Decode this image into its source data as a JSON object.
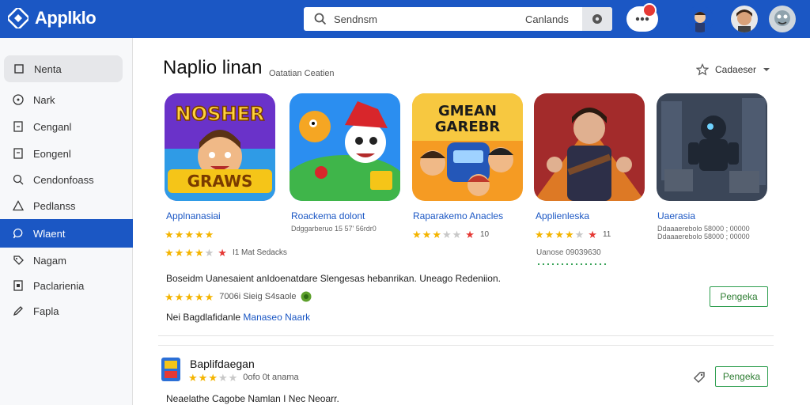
{
  "app": {
    "title": "Applklo"
  },
  "search": {
    "placeholder": "Sendnsm",
    "scope": "Canlands"
  },
  "sidebar": {
    "items": [
      {
        "label": "Nenta",
        "icon": "square-icon"
      },
      {
        "label": "Nark",
        "icon": "compass-icon"
      },
      {
        "label": "Cenganl",
        "icon": "page-icon"
      },
      {
        "label": "Eongenl",
        "icon": "page-icon"
      },
      {
        "label": "Cendonfoass",
        "icon": "search-icon"
      },
      {
        "label": "Pedlanss",
        "icon": "triangle-icon"
      },
      {
        "label": "Wlaent",
        "icon": "chat-icon"
      },
      {
        "label": "Nagam",
        "icon": "tag-icon"
      },
      {
        "label": "Paclarienia",
        "icon": "page-icon"
      },
      {
        "label": "Fapla",
        "icon": "pen-icon"
      }
    ],
    "active_index": 6
  },
  "main": {
    "title": "Naplio linan",
    "subtitle": "Oatatian Ceatien",
    "sort_label": "Cadaeser"
  },
  "apps": [
    {
      "name": "Applnanasiai",
      "art_label": "NOSHER GRAWS",
      "rating": 5,
      "extra_rating": 3.5,
      "extra_text": "I1 Mat Sedacks",
      "sub": ""
    },
    {
      "name": "Roackema dolont",
      "art_label": "",
      "rating": 0,
      "sub": "Ddggarberuo 15 57' 56rdr0"
    },
    {
      "name": "Raparakemo Anacles",
      "art_label": "GMEAN GAREBR",
      "rating": 3,
      "rating_text": "10",
      "sub": ""
    },
    {
      "name": "Applienleska",
      "art_label": "",
      "rating": 4,
      "rating_text": "11",
      "sub": "Uanose 09039630"
    },
    {
      "name": "Uaerasia",
      "art_label": "",
      "rating": 0,
      "sub": "Ddaaaerebolo 58000 ; 00000"
    }
  ],
  "description": {
    "text": "Boseidm Uanesaient anIdoenatdare Slengesas hebanrikan. Uneago Redeniion.",
    "rating_text": "7006i Sieig S4saole",
    "link_prefix": "Nei Bagdlafidanle ",
    "link_text": "Manaseo Naark",
    "button_label": "Pengeka"
  },
  "row2": {
    "title": "Baplifdaegan",
    "rating_text": "0ofo 0t anama",
    "description": "Neaelathe Cagobe Namlan I Nec Neoarr.",
    "button_label": "Pengeka"
  },
  "colors": {
    "brand": "#1b57c4",
    "star": "#f4b400",
    "accent_green": "#2e9e4f",
    "alert_red": "#e53935"
  }
}
